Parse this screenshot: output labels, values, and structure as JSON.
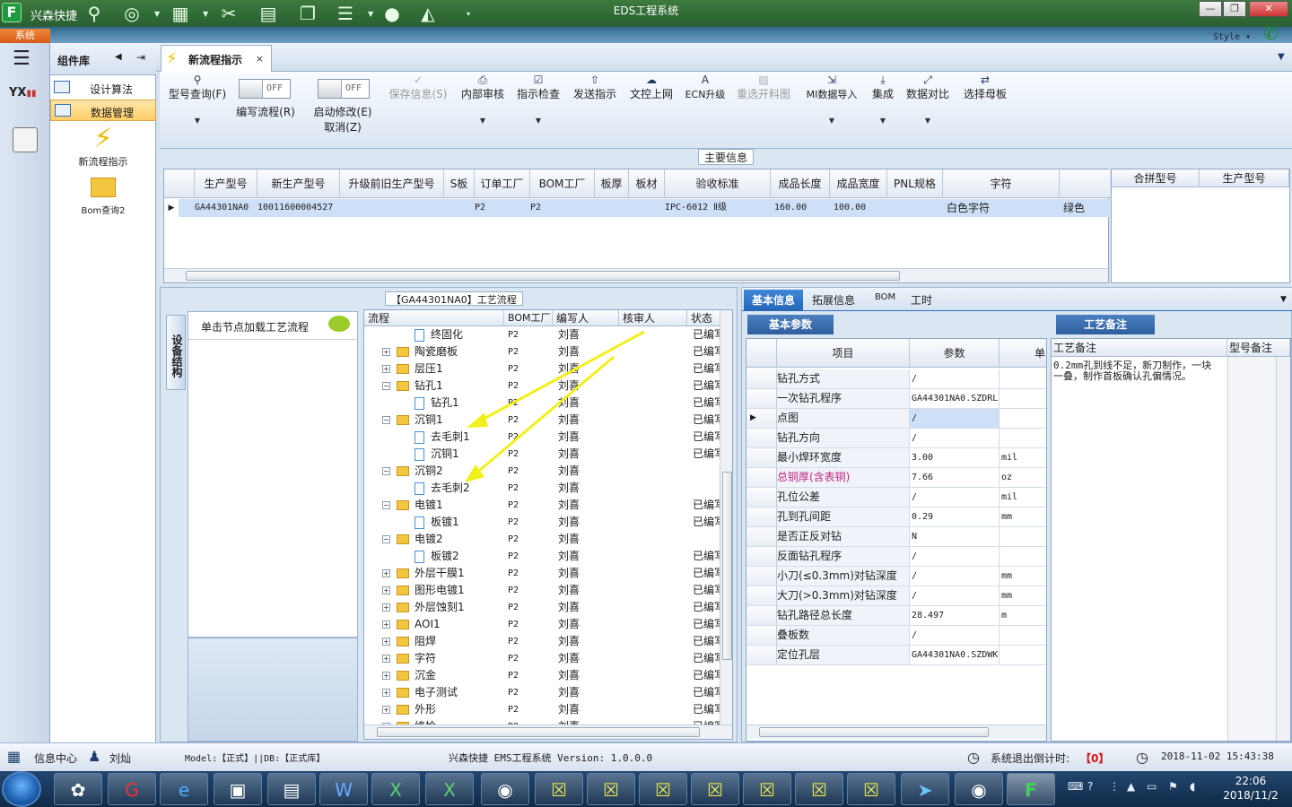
{
  "app": {
    "name": "兴森快捷",
    "window_title": "EDS工程系统",
    "system_tab": "系统",
    "style_label": "Style",
    "min": "—",
    "max": "❐",
    "close": "✕"
  },
  "toolbar_icons": [
    "search-icon",
    "globe-icon",
    "grid-icon",
    "cut-icon",
    "film-icon",
    "copy-icon",
    "list-icon",
    "user-icon",
    "chart-icon"
  ],
  "panel": {
    "title": "组件库",
    "items": [
      {
        "label": "设计算法"
      },
      {
        "label": "数据管理"
      }
    ],
    "tools": [
      {
        "label": "新流程指示"
      },
      {
        "label": "Bom查询2"
      }
    ]
  },
  "doc_tab": {
    "label": "新流程指示",
    "close": "×"
  },
  "ribbon": {
    "buttons": [
      {
        "label": "型号查询(F)"
      },
      {
        "label": "保存信息(S)"
      },
      {
        "label": "内部审核"
      },
      {
        "label": "指示检查"
      },
      {
        "label": "发送指示"
      },
      {
        "label": "文控上网"
      },
      {
        "label": "ECN升级"
      },
      {
        "label": "重选开料图"
      },
      {
        "label": "MI数据导入"
      },
      {
        "label": "集成"
      },
      {
        "label": "数据对比"
      },
      {
        "label": "选择母板"
      }
    ],
    "toggles": [
      {
        "state": "OFF",
        "label": "编写流程(R)"
      },
      {
        "state": "OFF",
        "label": "启动修改(E)",
        "label2": "取消(Z)"
      }
    ]
  },
  "main_info": {
    "title": "主要信息",
    "columns": [
      "生产型号",
      "新生产型号",
      "升级前旧生产型号",
      "S板",
      "订单工厂",
      "BOM工厂",
      "板厚",
      "板材",
      "验收标准",
      "成品长度",
      "成品宽度",
      "PNL规格",
      "字符"
    ],
    "row": {
      "生产型号": "GA44301NA0",
      "新生产型号": "10011600004527",
      "升级前旧生产型号": "",
      "S板": "P2",
      "订单工厂": "P2",
      "BOM工厂": "",
      "板厚": "",
      "板材": "IPC-6012 Ⅱ级",
      "成品长度": "160.00",
      "成品宽度": "100.00",
      "PNL规格": "",
      "字符": "白色字符",
      "extra": "绿色"
    },
    "side_columns": [
      "合拼型号",
      "生产型号"
    ]
  },
  "process": {
    "title": "【GA44301NA0】工艺流程",
    "vertical_tab": "设备结构",
    "hint": "单击节点加载工艺流程",
    "columns": [
      "流程",
      "BOM工厂",
      "编写人",
      "核审人",
      "状态"
    ],
    "rows": [
      {
        "name": "终固化",
        "level": 2,
        "type": "doc",
        "bom": "P2",
        "writer": "刘喜",
        "status": "已编写"
      },
      {
        "name": "陶瓷磨板",
        "level": 1,
        "type": "folder",
        "exp": "+",
        "bom": "P2",
        "writer": "刘喜",
        "status": "已编写"
      },
      {
        "name": "层压1",
        "level": 1,
        "type": "folder",
        "exp": "+",
        "bom": "P2",
        "writer": "刘喜",
        "status": "已编写"
      },
      {
        "name": "钻孔1",
        "level": 1,
        "type": "folder",
        "exp": "−",
        "bom": "P2",
        "writer": "刘喜",
        "status": "已编写"
      },
      {
        "name": "钻孔1",
        "level": 2,
        "type": "doc",
        "bom": "P2",
        "writer": "刘喜",
        "status": "已编写"
      },
      {
        "name": "沉铜1",
        "level": 1,
        "type": "folder",
        "exp": "−",
        "bom": "P2",
        "writer": "刘喜",
        "status": "已编写"
      },
      {
        "name": "去毛刺1",
        "level": 2,
        "type": "doc",
        "bom": "P2",
        "writer": "刘喜",
        "status": "已编写"
      },
      {
        "name": "沉铜1",
        "level": 2,
        "type": "doc",
        "bom": "P2",
        "writer": "刘喜",
        "status": "已编写"
      },
      {
        "name": "沉铜2",
        "level": 1,
        "type": "folder",
        "exp": "−",
        "bom": "P2",
        "writer": "刘喜",
        "status": ""
      },
      {
        "name": "去毛刺2",
        "level": 2,
        "type": "doc",
        "bom": "P2",
        "writer": "刘喜",
        "status": ""
      },
      {
        "name": "电镀1",
        "level": 1,
        "type": "folder",
        "exp": "−",
        "bom": "P2",
        "writer": "刘喜",
        "status": "已编写"
      },
      {
        "name": "板镀1",
        "level": 2,
        "type": "doc",
        "bom": "P2",
        "writer": "刘喜",
        "status": "已编写"
      },
      {
        "name": "电镀2",
        "level": 1,
        "type": "folder",
        "exp": "−",
        "bom": "P2",
        "writer": "刘喜",
        "status": ""
      },
      {
        "name": "板镀2",
        "level": 2,
        "type": "doc",
        "bom": "P2",
        "writer": "刘喜",
        "status": "已编写"
      },
      {
        "name": "外层干膜1",
        "level": 1,
        "type": "folder",
        "exp": "+",
        "bom": "P2",
        "writer": "刘喜",
        "status": "已编写"
      },
      {
        "name": "图形电镀1",
        "level": 1,
        "type": "folder",
        "exp": "+",
        "bom": "P2",
        "writer": "刘喜",
        "status": "已编写"
      },
      {
        "name": "外层蚀刻1",
        "level": 1,
        "type": "folder",
        "exp": "+",
        "bom": "P2",
        "writer": "刘喜",
        "status": "已编写"
      },
      {
        "name": "AOI1",
        "level": 1,
        "type": "folder",
        "exp": "+",
        "bom": "P2",
        "writer": "刘喜",
        "status": "已编写"
      },
      {
        "name": "阻焊",
        "level": 1,
        "type": "folder",
        "exp": "+",
        "bom": "P2",
        "writer": "刘喜",
        "status": "已编写"
      },
      {
        "name": "字符",
        "level": 1,
        "type": "folder",
        "exp": "+",
        "bom": "P2",
        "writer": "刘喜",
        "status": "已编写"
      },
      {
        "name": "沉金",
        "level": 1,
        "type": "folder",
        "exp": "+",
        "bom": "P2",
        "writer": "刘喜",
        "status": "已编写"
      },
      {
        "name": "电子测试",
        "level": 1,
        "type": "folder",
        "exp": "+",
        "bom": "P2",
        "writer": "刘喜",
        "status": "已编写"
      },
      {
        "name": "外形",
        "level": 1,
        "type": "folder",
        "exp": "+",
        "bom": "P2",
        "writer": "刘喜",
        "status": "已编写"
      },
      {
        "name": "终检",
        "level": 1,
        "type": "folder",
        "exp": "+",
        "bom": "P2",
        "writer": "刘喜",
        "status": "已编写"
      }
    ]
  },
  "right": {
    "tabs": [
      "基本信息",
      "拓展信息",
      "BOM",
      "工时"
    ],
    "basic_title": "基本参数",
    "param_columns": [
      "项目",
      "参数",
      "单"
    ],
    "params": [
      {
        "name": "钻孔方式",
        "value": "/",
        "unit": ""
      },
      {
        "name": "一次钻孔程序",
        "value": "GA44301NA0.SZDRL",
        "unit": ""
      },
      {
        "name": "点图",
        "value": "/",
        "unit": "",
        "selected": true
      },
      {
        "name": "钻孔方向",
        "value": "/",
        "unit": ""
      },
      {
        "name": "最小焊环宽度",
        "value": "3.00",
        "unit": "mil"
      },
      {
        "name": "总铜厚(含表铜)",
        "value": "7.66",
        "unit": "oz",
        "highlight": true
      },
      {
        "name": "孔位公差",
        "value": "/",
        "unit": "mil"
      },
      {
        "name": "孔到孔间距",
        "value": "0.29",
        "unit": "mm"
      },
      {
        "name": "是否正反对钻",
        "value": "N",
        "unit": ""
      },
      {
        "name": "反面钻孔程序",
        "value": "/",
        "unit": ""
      },
      {
        "name": "小刀(≤0.3mm)对钻深度",
        "value": "/",
        "unit": "mm"
      },
      {
        "name": "大刀(>0.3mm)对钻深度",
        "value": "/",
        "unit": "mm"
      },
      {
        "name": "钻孔路径总长度",
        "value": "28.497",
        "unit": "m"
      },
      {
        "name": "叠板数",
        "value": "/",
        "unit": ""
      },
      {
        "name": "定位孔层",
        "value": "GA44301NA0.SZDWK",
        "unit": ""
      }
    ],
    "craft_title": "工艺备注",
    "craft_columns": [
      "工艺备注",
      "型号备注"
    ],
    "craft_note": "0.2mm孔到线不足，新刀制作，一块一叠，制作首板确认孔偏情况。"
  },
  "statusbar": {
    "info_center": "信息中心",
    "user": "刘灿",
    "model": "Model:【正式】||DB:【正式库】",
    "system": "兴森快捷 EMS工程系统 Version: 1.0.0.0",
    "countdown_label": "系统退出倒计时:",
    "countdown_value": "【0】",
    "datetime": "2018-11-02 15:43:38"
  },
  "taskbar": {
    "time": "22:06",
    "date": "2018/11/2"
  },
  "colors": {
    "accent": "#2465b7",
    "arrow": "#f2ef1d",
    "highlight_text": "#c0247c"
  }
}
